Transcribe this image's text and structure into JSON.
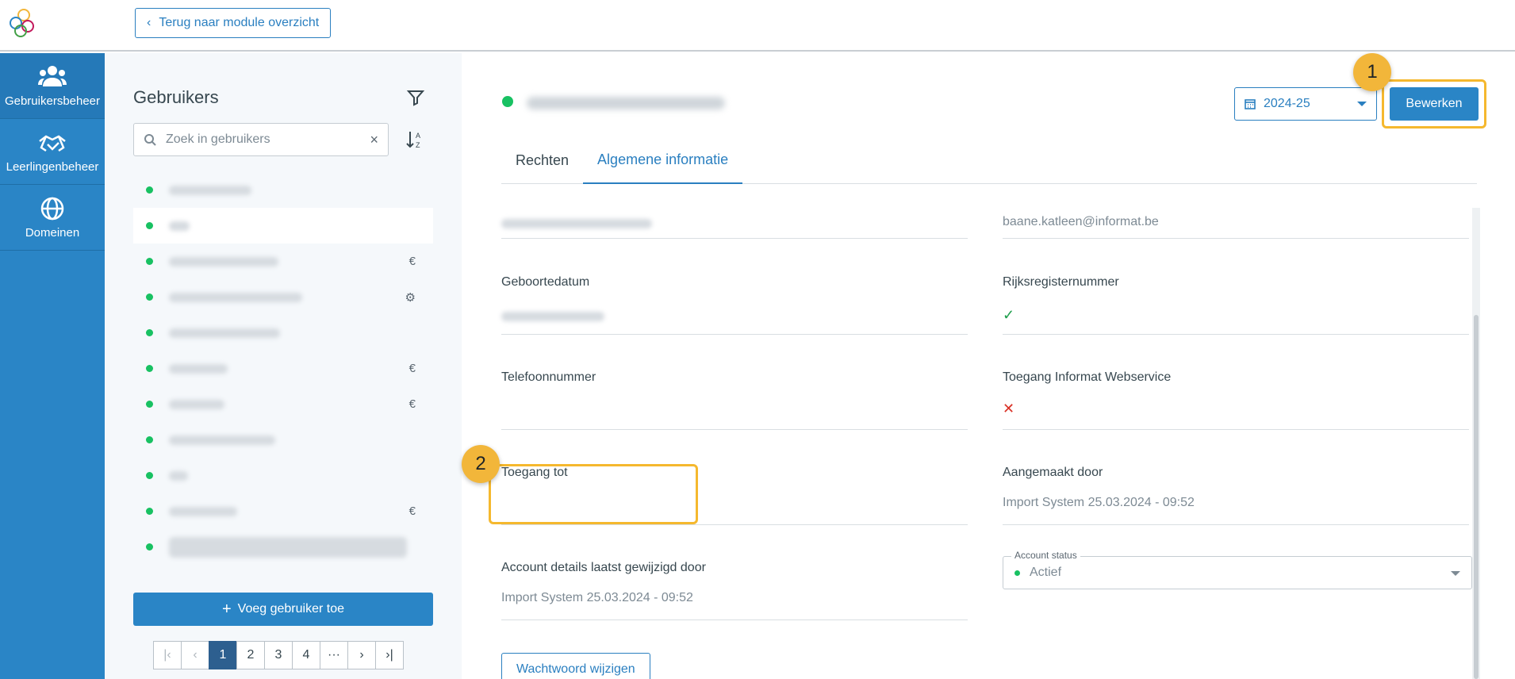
{
  "header": {
    "back_label": "Terug naar module overzicht"
  },
  "nav": {
    "items": [
      {
        "label": "Gebruikersbeheer",
        "icon": "users-icon"
      },
      {
        "label": "Leerlingenbeheer",
        "icon": "handshake-icon"
      },
      {
        "label": "Domeinen",
        "icon": "globe-icon"
      }
    ]
  },
  "users_panel": {
    "title": "Gebruikers",
    "search_placeholder": "Zoek in gebruikers",
    "add_label": "Voeg gebruiker toe",
    "rows": [
      {
        "icon": ""
      },
      {
        "icon": ""
      },
      {
        "icon": "€"
      },
      {
        "icon": "⚙"
      },
      {
        "icon": ""
      },
      {
        "icon": "€"
      },
      {
        "icon": "€"
      },
      {
        "icon": ""
      },
      {
        "icon": ""
      },
      {
        "icon": "€"
      },
      {
        "icon": ""
      }
    ],
    "pagination": {
      "pages": [
        "1",
        "2",
        "3",
        "4",
        "···"
      ],
      "current": "1"
    }
  },
  "detail": {
    "year": "2024-25",
    "edit_label": "Bewerken",
    "tabs": [
      "Rechten",
      "Algemene informatie"
    ],
    "active_tab": "Algemene informatie",
    "email": "baane.katleen@informat.be",
    "fields": {
      "birthdate_label": "Geboortedatum",
      "rrn_label": "Rijksregisternummer",
      "phone_label": "Telefoonnummer",
      "webservice_label": "Toegang Informat Webservice",
      "access_label": "Toegang tot",
      "created_label": "Aangemaakt door",
      "created_value": "Import System 25.03.2024 - 09:52",
      "modified_label": "Account details laatst gewijzigd door",
      "modified_value": "Import System 25.03.2024 - 09:52"
    },
    "account_status": {
      "label": "Account status",
      "value": "Actief"
    },
    "password_label": "Wachtwoord wijzigen"
  },
  "annotations": {
    "badge1": "1",
    "badge2": "2"
  },
  "colors": {
    "accent": "#2a85c6",
    "highlight": "#f5b82e",
    "status_ok": "#18c162"
  }
}
